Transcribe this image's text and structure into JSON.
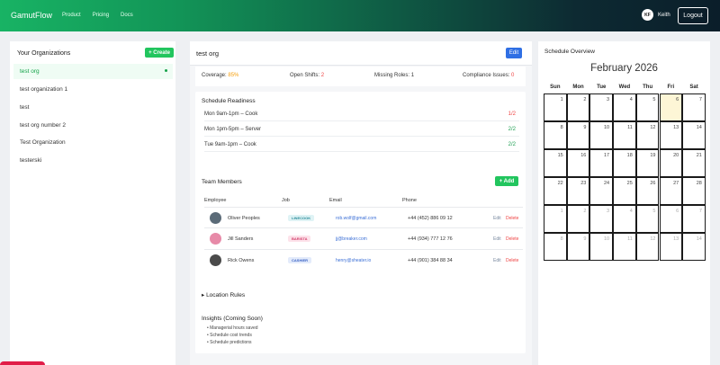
{
  "header": {
    "brand": "GamutFlow",
    "nav": [
      "Product",
      "Pricing",
      "Docs"
    ],
    "user_initials": "KF",
    "user_name": "Keith",
    "logout_label": "Logout",
    "gradient_colors": [
      "#18b364",
      "#0b1e2a"
    ]
  },
  "organizations": {
    "title": "Your Organizations",
    "create_label": "+ Create",
    "items": [
      "test org",
      "test organization 1",
      "test",
      "test org number 2",
      "Test Organization",
      "testerski"
    ]
  },
  "org_detail": {
    "title": "test org",
    "edit_label": "Edit",
    "coverage_label": "Coverage:",
    "coverage_value": "85%",
    "open_shifts_label": "Open Shifts:",
    "open_shifts_value": "2",
    "missing_roles_label": "Missing Roles:",
    "missing_roles_value": "1",
    "compliance_label": "Compliance Issues:",
    "compliance_value": "0"
  },
  "readiness": {
    "title": "Schedule Readiness",
    "rows": [
      {
        "label": "Mon 9am-1pm – Cook",
        "value": "1/2",
        "status": "red"
      },
      {
        "label": "Mon 1pm-5pm – Server",
        "value": "2/2",
        "status": "green"
      },
      {
        "label": "Tue 9am-1pm – Cook",
        "value": "2/2",
        "status": "green"
      }
    ]
  },
  "team": {
    "title": "Team Members",
    "add_label": "+ Add",
    "columns": [
      "Employee",
      "Job",
      "Email",
      "Phone"
    ],
    "edit_label": "Edit",
    "delete_label": "Delete",
    "members": [
      {
        "name": "Oliver Peoples",
        "job": "LINECOOK",
        "email": "rob.wolf@gmail.com",
        "phone": "+44 (452) 886 09 12",
        "tag_bg": "#dff3f5",
        "tag_fg": "#2b8c9a",
        "face": "#5b6b78"
      },
      {
        "name": "Jill Sanders",
        "job": "BARISTA",
        "email": "jj@breaker.com",
        "phone": "+44 (934) 777 12 76",
        "tag_bg": "#fde2ea",
        "tag_fg": "#d23f6b",
        "face": "#e78aa8"
      },
      {
        "name": "Rick Owens",
        "job": "CASHIER",
        "email": "henry@sheater.io",
        "phone": "+44 (901) 384 88 34",
        "tag_bg": "#e3ebfb",
        "tag_fg": "#3b63c4",
        "face": "#4a4a4a"
      }
    ]
  },
  "location_rules": {
    "label": "▸ Location Rules"
  },
  "insights": {
    "title": "Insights (Coming Soon)",
    "items": [
      "Managerial hours saved",
      "Schedule cost trends",
      "Schedule predictions"
    ]
  },
  "calendar": {
    "title": "Schedule Overview",
    "month": "February 2026",
    "weekdays": [
      "Sun",
      "Mon",
      "Tue",
      "Wed",
      "Thu",
      "Fri",
      "Sat"
    ],
    "weeks": [
      [
        "1",
        "2",
        "3",
        "4",
        "5",
        "6",
        "7"
      ],
      [
        "8",
        "9",
        "10",
        "11",
        "12",
        "13",
        "14"
      ],
      [
        "15",
        "16",
        "17",
        "18",
        "19",
        "20",
        "21"
      ],
      [
        "22",
        "23",
        "24",
        "25",
        "26",
        "27",
        "28"
      ],
      [
        "1",
        "2",
        "3",
        "4",
        "5",
        "6",
        "7"
      ],
      [
        "8",
        "9",
        "10",
        "11",
        "12",
        "13",
        "14"
      ]
    ],
    "today": "6"
  }
}
